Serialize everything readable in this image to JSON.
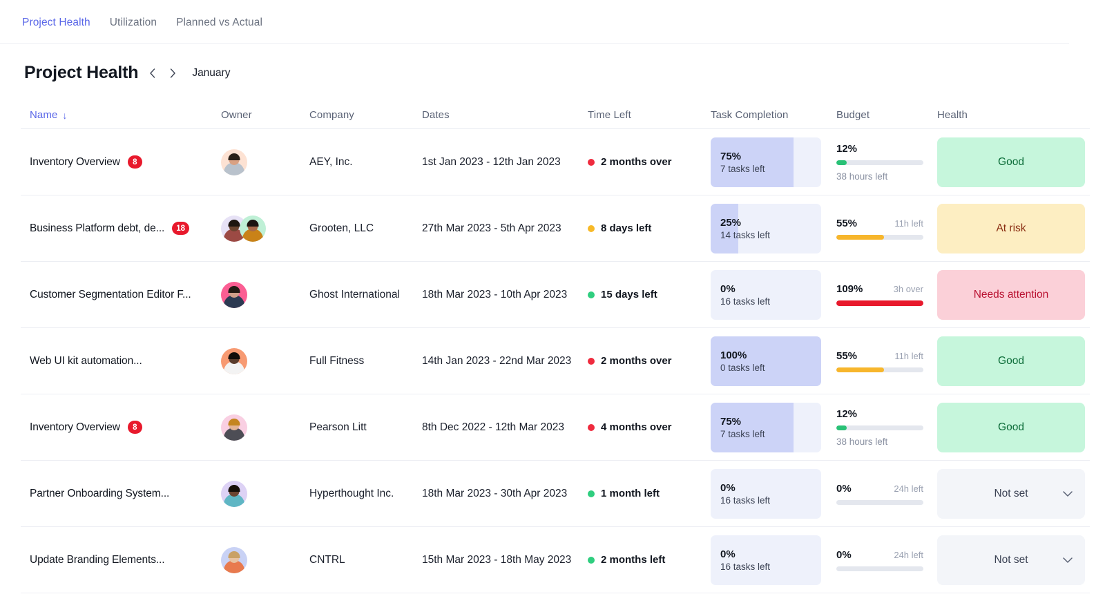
{
  "tabs": [
    {
      "label": "Project Health",
      "active": true
    },
    {
      "label": "Utilization",
      "active": false
    },
    {
      "label": "Planned vs Actual",
      "active": false
    }
  ],
  "header": {
    "title": "Project Health",
    "prev_icon": "chevron-left-icon",
    "next_icon": "chevron-right-icon",
    "month": "January"
  },
  "table": {
    "columns": [
      {
        "key": "name",
        "label": "Name",
        "sorted": true,
        "sort_arrow": "↓"
      },
      {
        "key": "owner",
        "label": "Owner",
        "sorted": false
      },
      {
        "key": "comp",
        "label": "Company",
        "sorted": false
      },
      {
        "key": "dates",
        "label": "Dates",
        "sorted": false
      },
      {
        "key": "time",
        "label": "Time Left",
        "sorted": false
      },
      {
        "key": "task",
        "label": "Task Completion",
        "sorted": false
      },
      {
        "key": "budget",
        "label": "Budget",
        "sorted": false
      },
      {
        "key": "health",
        "label": "Health",
        "sorted": false
      }
    ],
    "rows": [
      {
        "name": "Inventory Overview",
        "badge": "8",
        "owners": [
          {
            "skin": "#d9a183",
            "hair": "#2a2119",
            "shirt": "#b9c2cc",
            "bg": "#fde2d3"
          }
        ],
        "company": "AEY, Inc.",
        "dates": "1st Jan 2023 - 12th Jan 2023",
        "time_left": "2 months over",
        "time_color": "#ef2b3e",
        "task_pct": 75,
        "task_pct_label": "75%",
        "task_sub": "7 tasks left",
        "budget_pct_label": "12%",
        "budget_pct": 12,
        "budget_color": "#29c176",
        "budget_note": "",
        "budget_hours": "38 hours left",
        "health": "Good",
        "health_style": "good",
        "health_dropdown": false
      },
      {
        "name": "Business Platform debt, de...",
        "badge": "18",
        "owners": [
          {
            "skin": "#6b4430",
            "hair": "#1d1510",
            "shirt": "#9c4a44",
            "bg": "#e7e2f6"
          },
          {
            "skin": "#a8694a",
            "hair": "#1b1410",
            "shirt": "#c98218",
            "bg": "#bff0d6"
          }
        ],
        "company": "Grooten, LLC",
        "dates": "27th Mar 2023 - 5th Apr 2023",
        "time_left": "8 days left",
        "time_color": "#f7b928",
        "task_pct": 25,
        "task_pct_label": "25%",
        "task_sub": "14 tasks left",
        "budget_pct_label": "55%",
        "budget_pct": 55,
        "budget_color": "#f7b62c",
        "budget_note": "11h left",
        "budget_hours": "",
        "health": "At risk",
        "health_style": "atrisk",
        "health_dropdown": false
      },
      {
        "name": "Customer Segmentation Editor F...",
        "badge": "",
        "owners": [
          {
            "skin": "#d0a08a",
            "hair": "#241a14",
            "shirt": "#2c3a52",
            "bg": "#fb5e93"
          }
        ],
        "company": "Ghost International",
        "dates": "18th Mar 2023 - 10th Apr 2023",
        "time_left": "15 days left",
        "time_color": "#2fce7f",
        "task_pct": 0,
        "task_pct_label": "0%",
        "task_sub": "16 tasks left",
        "budget_pct_label": "109%",
        "budget_pct": 100,
        "budget_color": "#e8192c",
        "budget_note": "3h over",
        "budget_hours": "",
        "health": "Needs attention",
        "health_style": "attention",
        "health_dropdown": false
      },
      {
        "name": "Web UI kit automation...",
        "badge": "",
        "owners": [
          {
            "skin": "#5a3c2c",
            "hair": "#120d0a",
            "shirt": "#f3f3f3",
            "bg": "#f79a72"
          }
        ],
        "company": "Full Fitness",
        "dates": "14th Jan 2023 - 22nd Mar 2023",
        "time_left": "2 months over",
        "time_color": "#ef2b3e",
        "task_pct": 100,
        "task_pct_label": "100%",
        "task_sub": "0 tasks left",
        "budget_pct_label": "55%",
        "budget_pct": 55,
        "budget_color": "#f7b62c",
        "budget_note": "11h left",
        "budget_hours": "",
        "health": "Good",
        "health_style": "good",
        "health_dropdown": false
      },
      {
        "name": "Inventory Overview",
        "badge": "8",
        "owners": [
          {
            "skin": "#e3b495",
            "hair": "#c4851f",
            "shirt": "#4d4d55",
            "bg": "#f9cfe2"
          }
        ],
        "company": "Pearson Litt",
        "dates": "8th Dec 2022 - 12th Mar 2023",
        "time_left": "4 months over",
        "time_color": "#ef2b3e",
        "task_pct": 75,
        "task_pct_label": "75%",
        "task_sub": "7 tasks left",
        "budget_pct_label": "12%",
        "budget_pct": 12,
        "budget_color": "#29c176",
        "budget_note": "",
        "budget_hours": "38 hours left",
        "health": "Good",
        "health_style": "good",
        "health_dropdown": false
      },
      {
        "name": "Partner Onboarding System...",
        "badge": "",
        "owners": [
          {
            "skin": "#6b4430",
            "hair": "#171009",
            "shirt": "#5fb6c4",
            "bg": "#ddd2f5"
          }
        ],
        "company": "Hyperthought Inc.",
        "dates": "18th Mar 2023 - 30th Apr 2023",
        "time_left": "1 month left",
        "time_color": "#2fce7f",
        "task_pct": 0,
        "task_pct_label": "0%",
        "task_sub": "16 tasks left",
        "budget_pct_label": "0%",
        "budget_pct": 0,
        "budget_color": "#e4e7ee",
        "budget_note": "24h left",
        "budget_hours": "",
        "health": "Not set",
        "health_style": "notset",
        "health_dropdown": true
      },
      {
        "name": "Update Branding Elements...",
        "badge": "",
        "owners": [
          {
            "skin": "#e8c3a2",
            "hair": "#c9a165",
            "shirt": "#e87a4e",
            "bg": "#c9d2f5"
          }
        ],
        "company": "CNTRL",
        "dates": "15th Mar 2023 - 18th May 2023",
        "time_left": "2 months left",
        "time_color": "#2fce7f",
        "task_pct": 0,
        "task_pct_label": "0%",
        "task_sub": "16 tasks left",
        "budget_pct_label": "0%",
        "budget_pct": 0,
        "budget_color": "#e4e7ee",
        "budget_note": "24h left",
        "budget_hours": "",
        "health": "Not set",
        "health_style": "notset",
        "health_dropdown": true
      }
    ]
  }
}
